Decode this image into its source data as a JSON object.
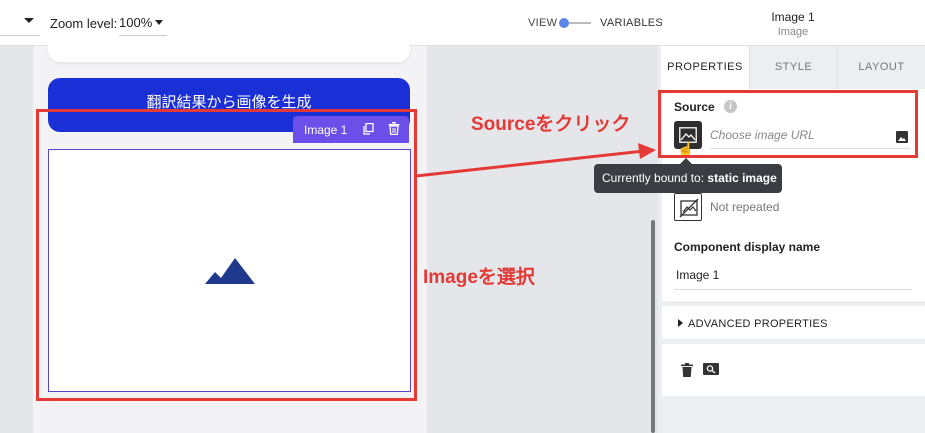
{
  "topbar": {
    "zoom_label": "Zoom level:",
    "zoom_value": "100%",
    "view_label": "VIEW",
    "variables_label": "VARIABLES",
    "selected_title": "Image 1",
    "selected_subtitle": "Image"
  },
  "canvas": {
    "generate_button_label": "翻訳結果から画像を生成",
    "component_toolbar_name": "Image 1"
  },
  "annotations": {
    "source_click": "Sourceをクリック",
    "image_select": "Imageを選択",
    "color": "#e53935"
  },
  "panel": {
    "tabs": [
      {
        "label": "PROPERTIES",
        "active": true
      },
      {
        "label": "STYLE",
        "active": false
      },
      {
        "label": "LAYOUT",
        "active": false
      }
    ],
    "source_label": "Source",
    "info_glyph": "i",
    "url_placeholder": "Choose image URL",
    "tooltip_prefix": "Currently bound to:",
    "tooltip_value": "static image",
    "repeat_text": "Not repeated",
    "display_name_label": "Component display name",
    "display_name_value": "Image 1",
    "advanced_label": "ADVANCED PROPERTIES"
  },
  "colors": {
    "accent_blue": "#1b2fd6",
    "selection_purple": "#6b4fe8",
    "toggle_blue": "#5b86e5"
  },
  "icons": [
    "chevron-down-icon",
    "copy-icon",
    "trash-icon",
    "image-placeholder-icon",
    "image-icon",
    "hand-cursor-icon",
    "no-repeat-icon",
    "search-icon"
  ]
}
